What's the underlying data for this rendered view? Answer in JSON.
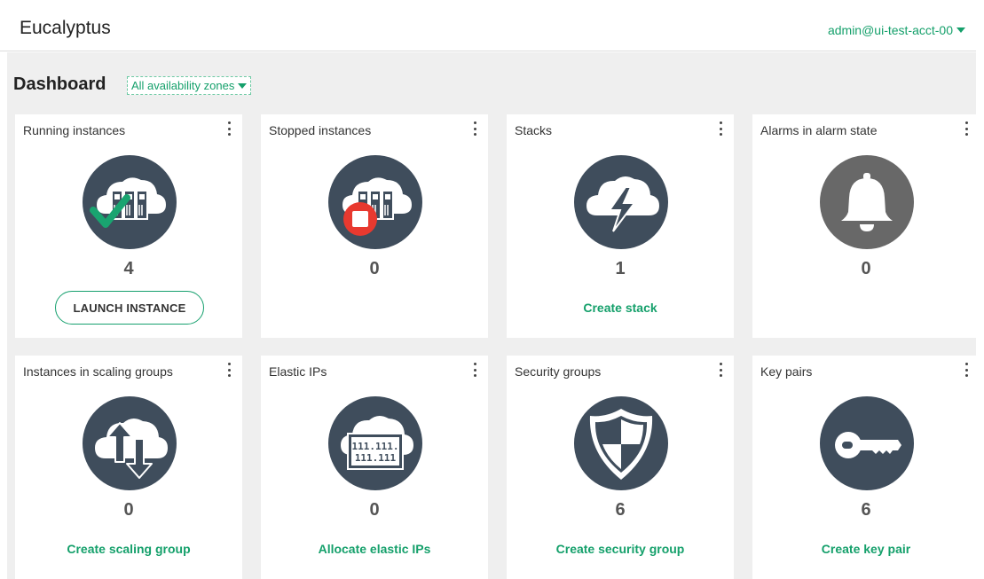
{
  "header": {
    "app_title": "Eucalyptus",
    "user_label": "admin@ui-test-acct-00"
  },
  "dashboard": {
    "title": "Dashboard",
    "zone_filter": "All availability zones"
  },
  "colors": {
    "accent": "#15a06b",
    "icon_circle": "#3f4d5c",
    "alarm_circle": "#686868",
    "check": "#19a470",
    "stop": "#e8392f"
  },
  "tiles": [
    {
      "title": "Running instances",
      "count": "4",
      "action": "LAUNCH INSTANCE",
      "icon": "running-instances-icon"
    },
    {
      "title": "Stopped instances",
      "count": "0",
      "action": "",
      "icon": "stopped-instances-icon"
    },
    {
      "title": "Stacks",
      "count": "1",
      "action": "Create stack",
      "icon": "stacks-icon"
    },
    {
      "title": "Alarms in alarm state",
      "count": "0",
      "action": "",
      "icon": "bell-icon"
    },
    {
      "title": "Instances in scaling groups",
      "count": "0",
      "action": "Create scaling group",
      "icon": "scaling-groups-icon"
    },
    {
      "title": "Elastic IPs",
      "count": "0",
      "action": "Allocate elastic IPs",
      "icon": "elastic-ips-icon",
      "icon_text_1": "111.111.",
      "icon_text_2": "111.111"
    },
    {
      "title": "Security groups",
      "count": "6",
      "action": "Create security group",
      "icon": "security-shield-icon"
    },
    {
      "title": "Key pairs",
      "count": "6",
      "action": "Create key pair",
      "icon": "key-icon"
    }
  ]
}
